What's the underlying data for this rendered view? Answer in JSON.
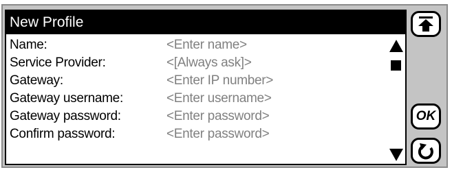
{
  "window": {
    "title": "New Profile"
  },
  "form": {
    "rows": [
      {
        "label": "Name:",
        "value": "<Enter name>"
      },
      {
        "label": "Service Provider:",
        "value": "<[Always ask]>"
      },
      {
        "label": "Gateway:",
        "value": "<Enter IP number>"
      },
      {
        "label": "Gateway username:",
        "value": "<Enter username>"
      },
      {
        "label": "Gateway password:",
        "value": "<Enter password>"
      },
      {
        "label": "Confirm password:",
        "value": "<Enter password>"
      }
    ]
  },
  "side_buttons": {
    "top_icon": "scroll-to-top-icon",
    "ok_label": "OK",
    "back_icon": "back-arrow-icon"
  },
  "colors": {
    "title_bar_bg": "#000000",
    "title_text": "#ffffff",
    "placeholder_text": "#808080",
    "frame_bg": "#c4c4c4"
  }
}
